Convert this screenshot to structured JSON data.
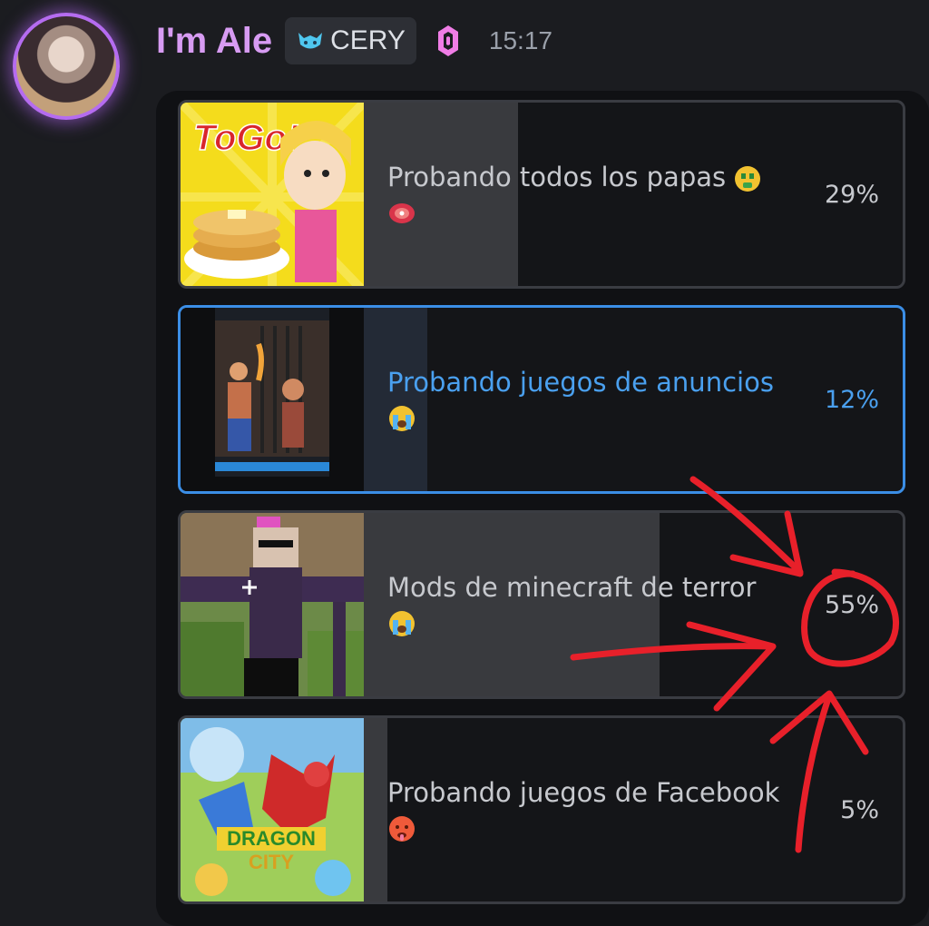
{
  "message": {
    "author": "I'm Ale",
    "tag_label": "CERY",
    "time": "15:17"
  },
  "colors": {
    "username": "#d79bf2",
    "selected_accent": "#3b8ee6",
    "annotation": "#e8202a"
  },
  "poll": {
    "options": [
      {
        "text": "Probando todos los papas",
        "emoji": "money-mouth-face, cut-of-meat",
        "percent_label": "29%",
        "percent": 29,
        "selected": false,
        "thumb": "papa-louie-to-go-thumbnail"
      },
      {
        "text": "Probando juegos de anuncios",
        "emoji": "loudly-crying-face",
        "percent_label": "12%",
        "percent": 12,
        "selected": true,
        "thumb": "game-ad-screenshot-thumbnail"
      },
      {
        "text": "Mods de minecraft de terror",
        "emoji": "loudly-crying-face",
        "percent_label": "55%",
        "percent": 55,
        "selected": false,
        "thumb": "minecraft-horror-mod-thumbnail"
      },
      {
        "text": "Probando juegos de Facebook",
        "emoji": "hot-face",
        "percent_label": "5%",
        "percent": 5,
        "selected": false,
        "thumb": "dragon-city-thumbnail"
      }
    ]
  }
}
